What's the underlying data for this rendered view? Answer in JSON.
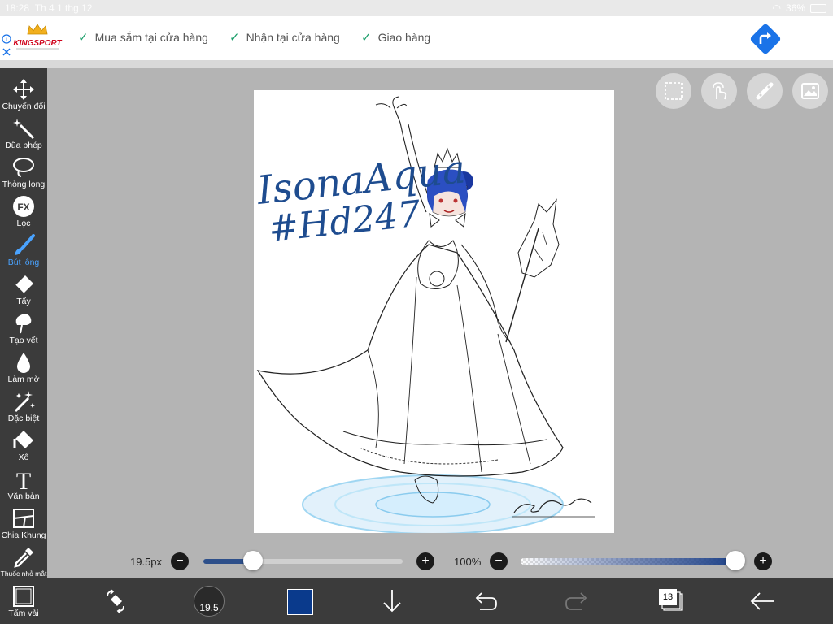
{
  "status_bar": {
    "time": "18:28",
    "date": "Th 4 1 thg 12",
    "battery": "36%"
  },
  "ad_banner": {
    "brand": "KINGSPORT",
    "tagline": "CUỘC SỐNG CỦA HẠNH PHÚC",
    "items": [
      "Mua sắm tại cửa hàng",
      "Nhận tại cửa hàng",
      "Giao hàng"
    ],
    "accent_color": "#1a73e8"
  },
  "sidebar": {
    "tools": [
      {
        "label": "Chuyển đổi",
        "icon": "move-icon"
      },
      {
        "label": "Đũa phép",
        "icon": "magic-wand-icon"
      },
      {
        "label": "Thòng lọng",
        "icon": "lasso-icon"
      },
      {
        "label": "Lọc",
        "icon": "fx-filter-icon"
      },
      {
        "label": "Bút lông",
        "icon": "brush-icon",
        "active": true
      },
      {
        "label": "Tẩy",
        "icon": "eraser-icon"
      },
      {
        "label": "Tạo vết",
        "icon": "smudge-icon"
      },
      {
        "label": "Làm mờ",
        "icon": "blur-drop-icon"
      },
      {
        "label": "Đặc biệt",
        "icon": "sparkle-icon"
      },
      {
        "label": "Xô",
        "icon": "bucket-icon"
      },
      {
        "label": "Văn bản",
        "icon": "text-icon"
      },
      {
        "label": "Chia Khung",
        "icon": "frame-divider-icon"
      },
      {
        "label": "Thuốc nhỏ mắt",
        "icon": "eyedropper-icon"
      },
      {
        "label": "Tấm vải",
        "icon": "canvas-icon"
      }
    ],
    "active_color": "#4aa3ff"
  },
  "canvas": {
    "signature_text_line1": "IsonaAqua",
    "signature_text_line2": "#Hd247"
  },
  "sliders": {
    "brush_size": "19.5px",
    "brush_size_level": 0.25,
    "opacity": "100%",
    "opacity_level": 1.0
  },
  "bottom_bar": {
    "brush_size_badge": "19.5",
    "current_color": "#0a3a8c",
    "layer_count": "13"
  }
}
